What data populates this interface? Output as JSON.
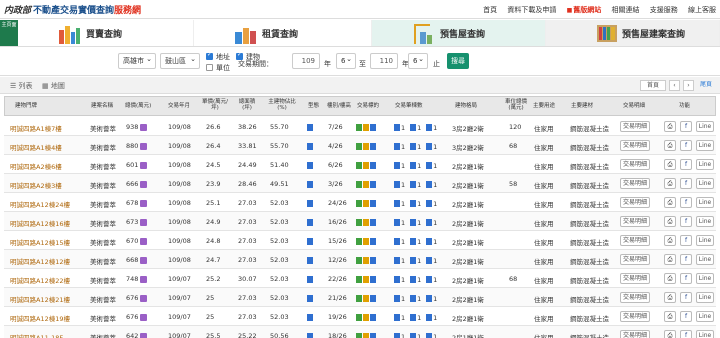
{
  "header": {
    "logo_mark": "内政部",
    "logo_title": "不動產交易實價查詢",
    "logo_hl": "服務網",
    "links": [
      "首頁",
      "資料下載及申請",
      "舊版網站",
      "相關連結",
      "支援服務",
      "線上客服"
    ]
  },
  "tabs": {
    "home": "主頁面",
    "buy": "買賣查詢",
    "rent": "租賃查詢",
    "presale": "預售屋查詢",
    "presale_project": "預售屋建案查詢"
  },
  "filter": {
    "city": "高雄市",
    "district": "鼓山區",
    "cb_address": "地址",
    "cb_community": "建物",
    "cb_unit": "單位",
    "period_label": "交易期間：",
    "year_from": "109",
    "month_from": "6",
    "year_to": "110",
    "month_to": "6",
    "year_unit": "年",
    "month_unit": "月",
    "to_label": "至",
    "till": "止",
    "search": "搜尋"
  },
  "viewbar": {
    "list": "列表",
    "map": "地圖",
    "first": "首頁",
    "prev": "‹",
    "next": "›",
    "last": "尾頁"
  },
  "columns": [
    "建物門牌",
    "建案名稱",
    "總價(萬元)",
    "交易年月",
    "單價(萬元/坪)",
    "總面積(坪)",
    "主建物佔比(%)",
    "型態",
    "樓別/樓高",
    "交易標的",
    "交易筆棟數",
    "建物格局",
    "車位總價(萬元)",
    "主要用途",
    "主要建材",
    "交易明細",
    "功能"
  ],
  "rows": [
    {
      "addr": "明誠四路A1棟7樓",
      "name": "美術薈萃",
      "price": "938",
      "ym": "109/08",
      "unit": "26.6",
      "area": "38.26",
      "ratio": "55.70",
      "floor": "7/26",
      "layout": "3房2廳2衛",
      "park": "120",
      "use": "住家用",
      "mat": "鋼筋混凝土造"
    },
    {
      "addr": "明誠四路A1棟4樓",
      "name": "美術薈萃",
      "price": "880",
      "ym": "109/08",
      "unit": "26.4",
      "area": "33.81",
      "ratio": "55.70",
      "floor": "4/26",
      "layout": "3房2廳2衛",
      "park": "68",
      "use": "住家用",
      "mat": "鋼筋混凝土造"
    },
    {
      "addr": "明誠四路A2棟6樓",
      "name": "美術薈萃",
      "price": "601",
      "ym": "109/08",
      "unit": "24.5",
      "area": "24.49",
      "ratio": "51.40",
      "floor": "6/26",
      "layout": "2房2廳1衛",
      "park": "",
      "use": "住家用",
      "mat": "鋼筋混凝土造"
    },
    {
      "addr": "明誠四路A2棟3樓",
      "name": "美術薈萃",
      "price": "666",
      "ym": "109/08",
      "unit": "23.9",
      "area": "28.46",
      "ratio": "49.51",
      "floor": "3/26",
      "layout": "2房2廳1衛",
      "park": "58",
      "use": "住家用",
      "mat": "鋼筋混凝土造"
    },
    {
      "addr": "明誠四路A12棟24樓",
      "name": "美術薈萃",
      "price": "678",
      "ym": "109/08",
      "unit": "25.1",
      "area": "27.03",
      "ratio": "52.03",
      "floor": "24/26",
      "layout": "2房2廳1衛",
      "park": "",
      "use": "住家用",
      "mat": "鋼筋混凝土造"
    },
    {
      "addr": "明誠四路A12棟16樓",
      "name": "美術薈萃",
      "price": "673",
      "ym": "109/08",
      "unit": "24.9",
      "area": "27.03",
      "ratio": "52.03",
      "floor": "16/26",
      "layout": "2房2廳1衛",
      "park": "",
      "use": "住家用",
      "mat": "鋼筋混凝土造"
    },
    {
      "addr": "明誠四路A12棟15樓",
      "name": "美術薈萃",
      "price": "670",
      "ym": "109/08",
      "unit": "24.8",
      "area": "27.03",
      "ratio": "52.03",
      "floor": "15/26",
      "layout": "2房2廳1衛",
      "park": "",
      "use": "住家用",
      "mat": "鋼筋混凝土造"
    },
    {
      "addr": "明誠四路A12棟12樓",
      "name": "美術薈萃",
      "price": "668",
      "ym": "109/08",
      "unit": "24.7",
      "area": "27.03",
      "ratio": "52.03",
      "floor": "12/26",
      "layout": "2房2廳1衛",
      "park": "",
      "use": "住家用",
      "mat": "鋼筋混凝土造"
    },
    {
      "addr": "明誠四路A12棟22樓",
      "name": "美術薈萃",
      "price": "748",
      "ym": "109/07",
      "unit": "25.2",
      "area": "30.07",
      "ratio": "52.03",
      "floor": "22/26",
      "layout": "2房2廳1衛",
      "park": "68",
      "use": "住家用",
      "mat": "鋼筋混凝土造"
    },
    {
      "addr": "明誠四路A12棟21樓",
      "name": "美術薈萃",
      "price": "676",
      "ym": "109/07",
      "unit": "25",
      "area": "27.03",
      "ratio": "52.03",
      "floor": "21/26",
      "layout": "2房2廳1衛",
      "park": "",
      "use": "住家用",
      "mat": "鋼筋混凝土造"
    },
    {
      "addr": "明誠四路A12棟19樓",
      "name": "美術薈萃",
      "price": "676",
      "ym": "109/07",
      "unit": "25",
      "area": "27.03",
      "ratio": "52.03",
      "floor": "19/26",
      "layout": "2房2廳1衛",
      "park": "",
      "use": "住家用",
      "mat": "鋼筋混凝土造"
    },
    {
      "addr": "明誠四路A11-18F",
      "name": "美術薈萃",
      "price": "642",
      "ym": "109/07",
      "unit": "25.5",
      "area": "25.22",
      "ratio": "50.56",
      "floor": "18/26",
      "layout": "2房1廳1衛",
      "park": "",
      "use": "住家用",
      "mat": "鋼筋混凝土造"
    }
  ],
  "row_labels": {
    "detail": "交易明細",
    "print": "⎙",
    "fb": "f",
    "line": "Line",
    "count": "1"
  },
  "colors": {
    "accent": "#16916e",
    "addr": "#b06a10",
    "badge": "#9a5fc6"
  }
}
